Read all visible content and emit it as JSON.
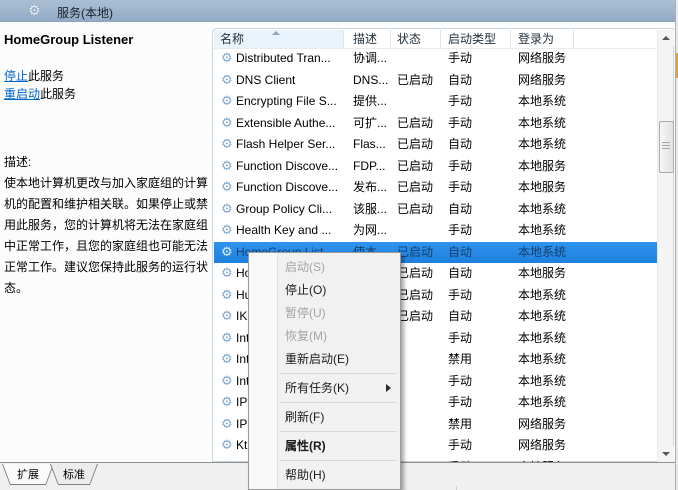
{
  "colors": {
    "topbar_hi": "#aabfd4",
    "topbar_lo": "#92abc5",
    "link": "#0066cc",
    "gear": "#82a9cc",
    "sorted_col": "#e9f3fb",
    "sel_hi": "#2f93f0",
    "sel_lo": "#1e80dd",
    "sel_text": "#14406b",
    "menu_bg": "#f1f1f1",
    "orange": "#e69b3c"
  },
  "topbar": {
    "title": "服务(本地)",
    "icon": "services-gear-icon"
  },
  "left_pane": {
    "service_title": "HomeGroup Listener",
    "stop_link": "停止",
    "stop_suffix": "此服务",
    "restart_link": "重启动",
    "restart_suffix": "此服务",
    "description_label": "描述:",
    "description_text": "使本地计算机更改与加入家庭组的计算机的配置和维护相关联。如果停止或禁用此服务，您的计算机将无法在家庭组中正常工作，且您的家庭组也可能无法正常工作。建议您保持此服务的运行状态。"
  },
  "table": {
    "columns": [
      "名称",
      "描述",
      "状态",
      "启动类型",
      "登录为"
    ],
    "rows": [
      {
        "name": "Distributed Tran...",
        "desc": "协调...",
        "status": "",
        "startup": "手动",
        "logon": "网络服务",
        "selected": false
      },
      {
        "name": "DNS Client",
        "desc": "DNS...",
        "status": "已启动",
        "startup": "自动",
        "logon": "网络服务",
        "selected": false
      },
      {
        "name": "Encrypting File S...",
        "desc": "提供...",
        "status": "",
        "startup": "手动",
        "logon": "本地系统",
        "selected": false
      },
      {
        "name": "Extensible Authe...",
        "desc": "可扩...",
        "status": "已启动",
        "startup": "手动",
        "logon": "本地系统",
        "selected": false
      },
      {
        "name": "Flash Helper Ser...",
        "desc": "Flas...",
        "status": "已启动",
        "startup": "自动",
        "logon": "本地系统",
        "selected": false
      },
      {
        "name": "Function Discove...",
        "desc": "FDP...",
        "status": "已启动",
        "startup": "手动",
        "logon": "本地服务",
        "selected": false
      },
      {
        "name": "Function Discove...",
        "desc": "发布...",
        "status": "已启动",
        "startup": "手动",
        "logon": "本地服务",
        "selected": false
      },
      {
        "name": "Group Policy Cli...",
        "desc": "该服...",
        "status": "已启动",
        "startup": "自动",
        "logon": "本地系统",
        "selected": false
      },
      {
        "name": "Health Key and ...",
        "desc": "为网...",
        "status": "",
        "startup": "手动",
        "logon": "本地系统",
        "selected": false
      },
      {
        "name": "HomeGroup List...",
        "desc": "使本...",
        "status": "已启动",
        "startup": "自动",
        "logon": "本地系统",
        "selected": true
      },
      {
        "name": "Ho",
        "desc": "",
        "status": "已启动",
        "startup": "自动",
        "logon": "本地服务",
        "selected": false
      },
      {
        "name": "Hu",
        "desc": "",
        "status": "已启动",
        "startup": "手动",
        "logon": "本地系统",
        "selected": false
      },
      {
        "name": "IKE",
        "desc": "",
        "status": "已启动",
        "startup": "自动",
        "logon": "本地系统",
        "selected": false
      },
      {
        "name": "Int",
        "desc": "",
        "status": "",
        "startup": "手动",
        "logon": "本地系统",
        "selected": false
      },
      {
        "name": "Int",
        "desc": "",
        "status": "",
        "startup": "禁用",
        "logon": "本地系统",
        "selected": false
      },
      {
        "name": "Int",
        "desc": "",
        "status": "",
        "startup": "手动",
        "logon": "本地系统",
        "selected": false
      },
      {
        "name": "IP",
        "desc": "",
        "status": "",
        "startup": "手动",
        "logon": "本地系统",
        "selected": false
      },
      {
        "name": "IPs",
        "desc": "",
        "status": "",
        "startup": "禁用",
        "logon": "网络服务",
        "selected": false
      },
      {
        "name": "Ktr",
        "desc": "",
        "status": "",
        "startup": "手动",
        "logon": "网络服务",
        "selected": false
      },
      {
        "name": "Lin",
        "desc": "",
        "status": "",
        "startup": "手动",
        "logon": "本地服务",
        "selected": false
      }
    ]
  },
  "context_menu": {
    "items": [
      {
        "label": "启动(S)",
        "name": "menu-item-start",
        "enabled": false,
        "bold": false,
        "submenu": false,
        "separator_after": false
      },
      {
        "label": "停止(O)",
        "name": "menu-item-stop",
        "enabled": true,
        "bold": false,
        "submenu": false,
        "separator_after": false
      },
      {
        "label": "暂停(U)",
        "name": "menu-item-pause",
        "enabled": false,
        "bold": false,
        "submenu": false,
        "separator_after": false
      },
      {
        "label": "恢复(M)",
        "name": "menu-item-resume",
        "enabled": false,
        "bold": false,
        "submenu": false,
        "separator_after": false
      },
      {
        "label": "重新启动(E)",
        "name": "menu-item-restart",
        "enabled": true,
        "bold": false,
        "submenu": false,
        "separator_after": true
      },
      {
        "label": "所有任务(K)",
        "name": "menu-item-all-tasks",
        "enabled": true,
        "bold": false,
        "submenu": true,
        "separator_after": true
      },
      {
        "label": "刷新(F)",
        "name": "menu-item-refresh",
        "enabled": true,
        "bold": false,
        "submenu": false,
        "separator_after": true
      },
      {
        "label": "属性(R)",
        "name": "menu-item-properties",
        "enabled": true,
        "bold": true,
        "submenu": false,
        "separator_after": true
      },
      {
        "label": "帮助(H)",
        "name": "menu-item-help",
        "enabled": true,
        "bold": false,
        "submenu": false,
        "separator_after": false
      }
    ]
  },
  "footer": {
    "tabs": [
      "扩展",
      "标准"
    ]
  }
}
